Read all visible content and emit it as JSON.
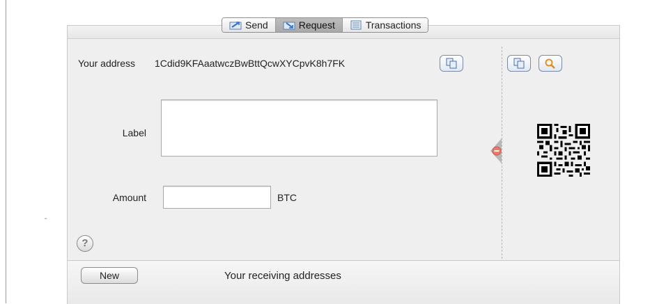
{
  "tabs": [
    {
      "label": "Send",
      "icon": "send-icon",
      "active": false
    },
    {
      "label": "Request",
      "icon": "request-icon",
      "active": true
    },
    {
      "label": "Transactions",
      "icon": "transactions-icon",
      "active": false
    }
  ],
  "form": {
    "address_label": "Your address",
    "address_value": "1Cdid9KFAaatwczBwBttQcwXYCpvK8h7FK",
    "label_label": "Label",
    "label_value": "",
    "amount_label": "Amount",
    "amount_value": "",
    "currency": "BTC"
  },
  "icons": {
    "copy": "copy-icon",
    "zoom": "magnifier-icon",
    "help": "?",
    "collapse": "collapse-arrow-icon"
  },
  "bottom": {
    "new_label": "New",
    "receiving_title": "Your receiving addresses"
  },
  "colors": {
    "panel_bg": "#efefef",
    "active_tab": "#b0b0b0",
    "button_border": "#7a8aa6",
    "zoom_orange": "#e08a1c"
  }
}
